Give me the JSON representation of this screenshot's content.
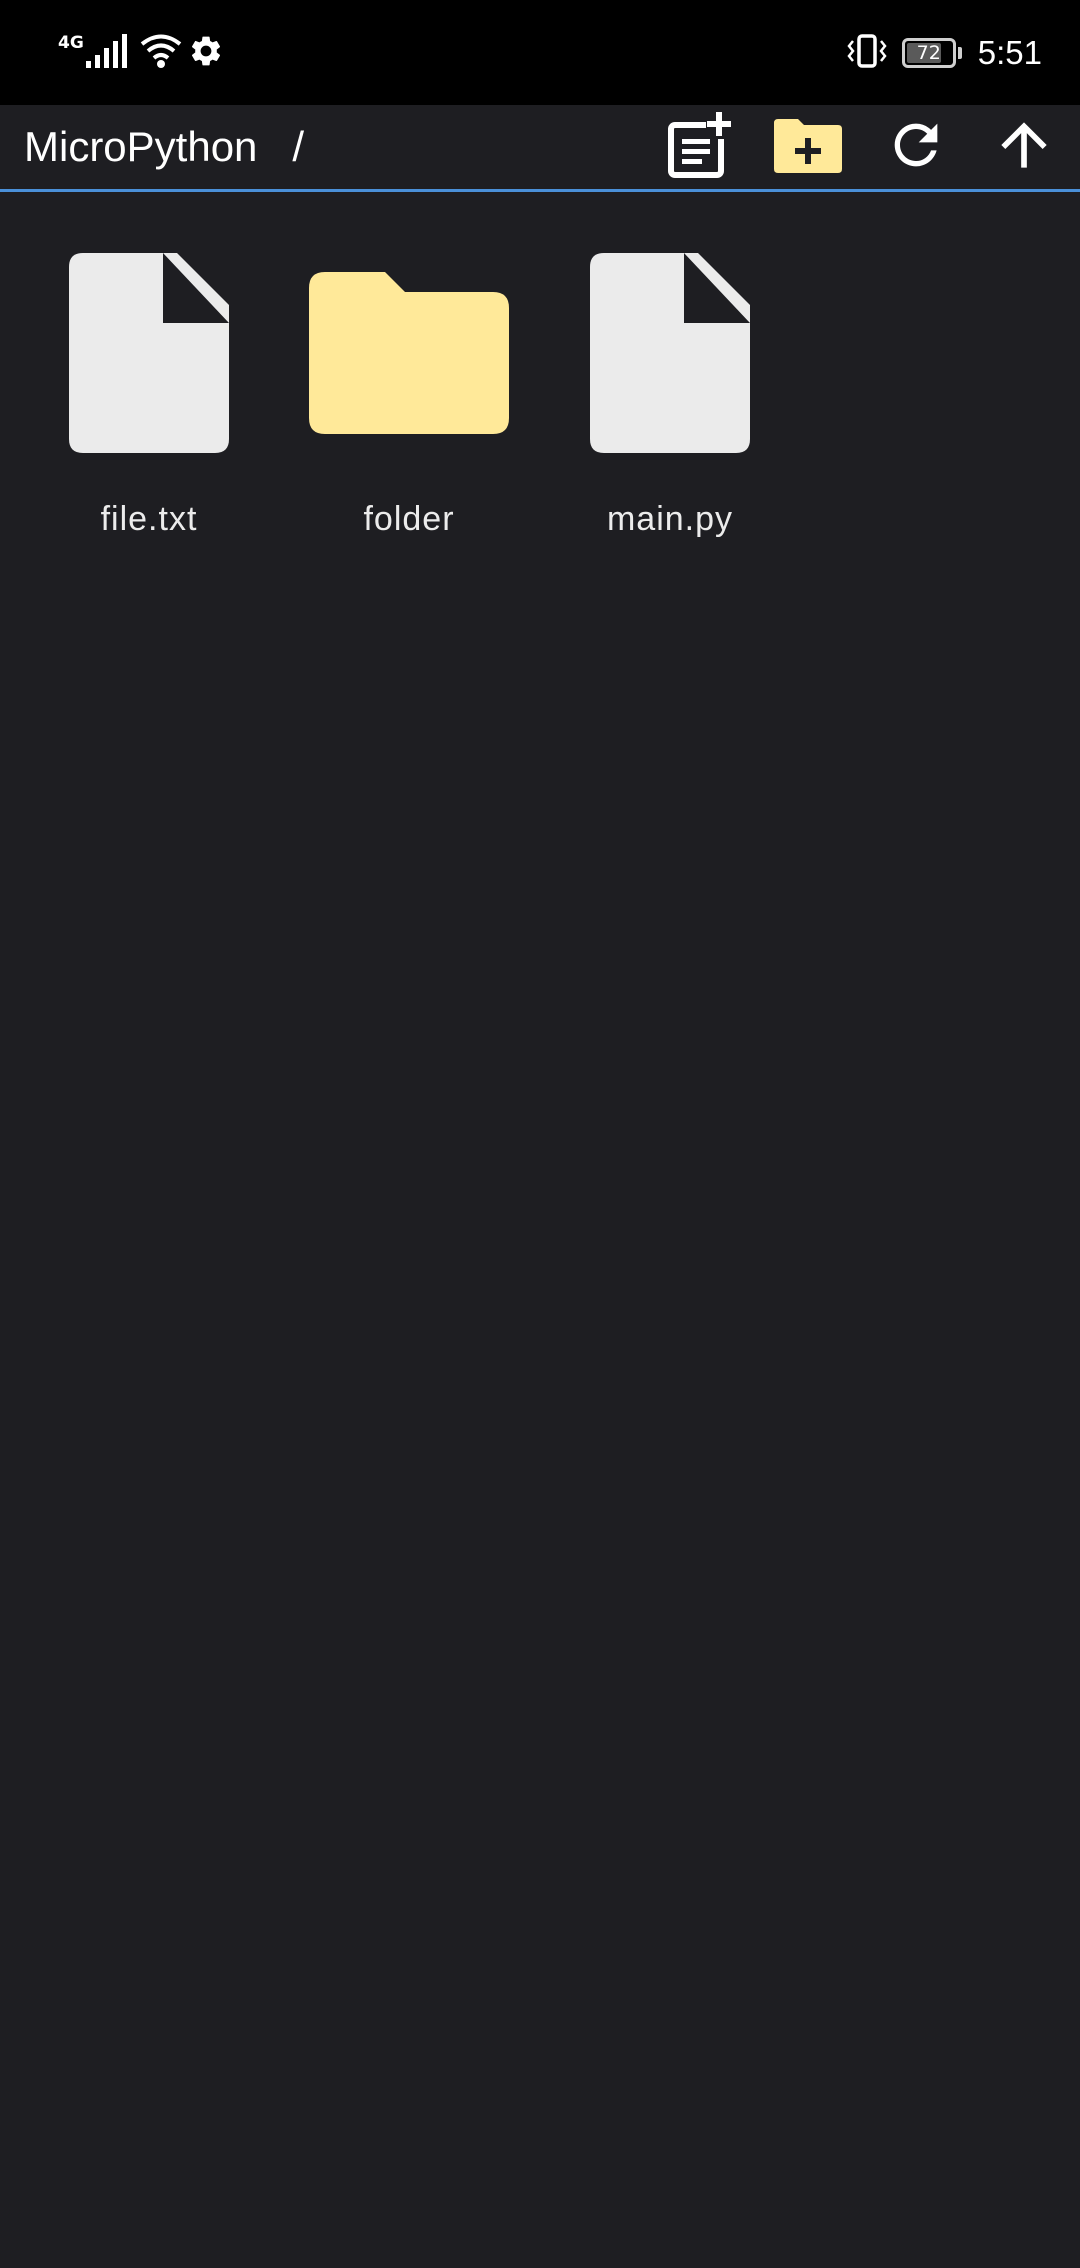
{
  "status_bar": {
    "network_type": "4G",
    "battery_level": "72",
    "time": "5:51"
  },
  "app_bar": {
    "title": "MicroPython   /",
    "actions": [
      {
        "name": "new-file",
        "icon": "note-add-icon"
      },
      {
        "name": "new-folder",
        "icon": "create-new-folder-icon"
      },
      {
        "name": "refresh",
        "icon": "refresh-icon"
      },
      {
        "name": "up",
        "icon": "arrow-up-icon"
      }
    ]
  },
  "files": [
    {
      "name": "file.txt",
      "type": "file"
    },
    {
      "name": "folder",
      "type": "folder"
    },
    {
      "name": "main.py",
      "type": "file"
    }
  ],
  "colors": {
    "background": "#1e1e22",
    "status_bar": "#000000",
    "accent_line": "#4a90d9",
    "folder": "#ffe999",
    "file": "#ebebeb"
  }
}
